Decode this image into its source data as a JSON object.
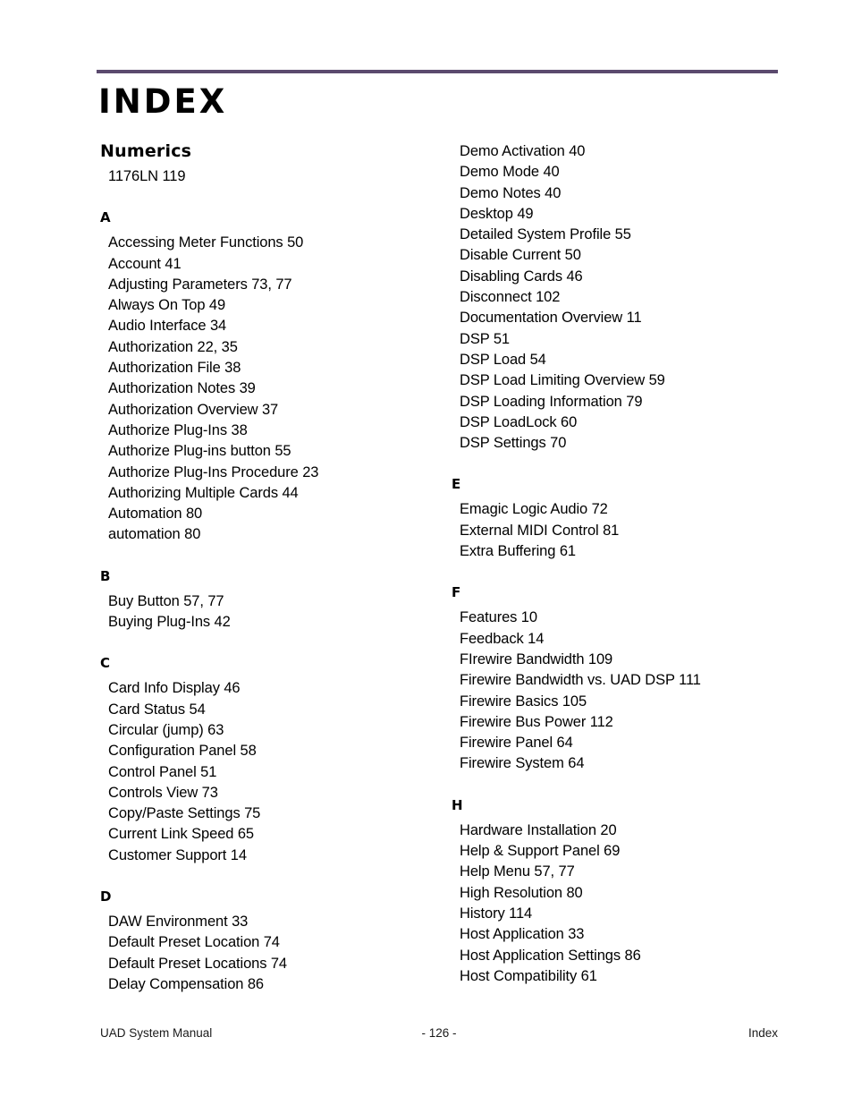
{
  "header": {
    "title": "INDEX",
    "rule_color": "#5B4A6E"
  },
  "columns": {
    "left": [
      {
        "heading": "Numerics",
        "heading_style": "word",
        "entries": [
          "1176LN 119"
        ]
      },
      {
        "heading": "A",
        "heading_style": "letter",
        "entries": [
          "Accessing Meter Functions 50",
          "Account 41",
          "Adjusting Parameters 73, 77",
          "Always On Top 49",
          "Audio Interface 34",
          "Authorization 22, 35",
          "Authorization File 38",
          "Authorization Notes 39",
          "Authorization Overview 37",
          "Authorize Plug-Ins 38",
          "Authorize Plug-ins button 55",
          "Authorize Plug-Ins Procedure 23",
          "Authorizing Multiple Cards 44",
          "Automation 80",
          "automation 80"
        ]
      },
      {
        "heading": "B",
        "heading_style": "letter",
        "entries": [
          "Buy Button 57, 77",
          "Buying Plug-Ins 42"
        ]
      },
      {
        "heading": "C",
        "heading_style": "letter",
        "entries": [
          "Card Info Display 46",
          "Card Status 54",
          "Circular (jump) 63",
          "Configuration Panel 58",
          "Control Panel 51",
          "Controls View 73",
          "Copy/Paste Settings 75",
          "Current Link Speed 65",
          "Customer Support 14"
        ]
      },
      {
        "heading": "D",
        "heading_style": "letter",
        "entries": [
          "DAW Environment 33",
          "Default Preset Location 74",
          "Default Preset Locations 74",
          "Delay Compensation 86"
        ]
      }
    ],
    "right": [
      {
        "heading": "",
        "heading_style": "none",
        "entries": [
          "Demo Activation 40",
          "Demo Mode 40",
          "Demo Notes 40",
          "Desktop 49",
          "Detailed System Profile 55",
          "Disable Current 50",
          "Disabling Cards 46",
          "Disconnect 102",
          "Documentation Overview 11",
          "DSP 51",
          "DSP Load 54",
          "DSP Load Limiting Overview 59",
          "DSP Loading Information 79",
          "DSP LoadLock 60",
          "DSP Settings 70"
        ]
      },
      {
        "heading": "E",
        "heading_style": "letter",
        "entries": [
          "Emagic Logic Audio 72",
          "External MIDI Control 81",
          "Extra Buffering 61"
        ]
      },
      {
        "heading": "F",
        "heading_style": "letter",
        "entries": [
          "Features 10",
          "Feedback 14",
          "FIrewire Bandwidth 109",
          "Firewire Bandwidth vs. UAD DSP 111",
          "Firewire Basics 105",
          "Firewire Bus Power 112",
          "Firewire Panel 64",
          "Firewire System 64"
        ]
      },
      {
        "heading": "H",
        "heading_style": "letter",
        "entries": [
          "Hardware Installation 20",
          "Help & Support Panel 69",
          "Help Menu 57, 77",
          "High Resolution 80",
          "History 114",
          "Host Application 33",
          "Host Application Settings 86",
          "Host Compatibility 61"
        ]
      }
    ]
  },
  "footer": {
    "left": "UAD System Manual",
    "center": "- 126 -",
    "right": "Index"
  }
}
